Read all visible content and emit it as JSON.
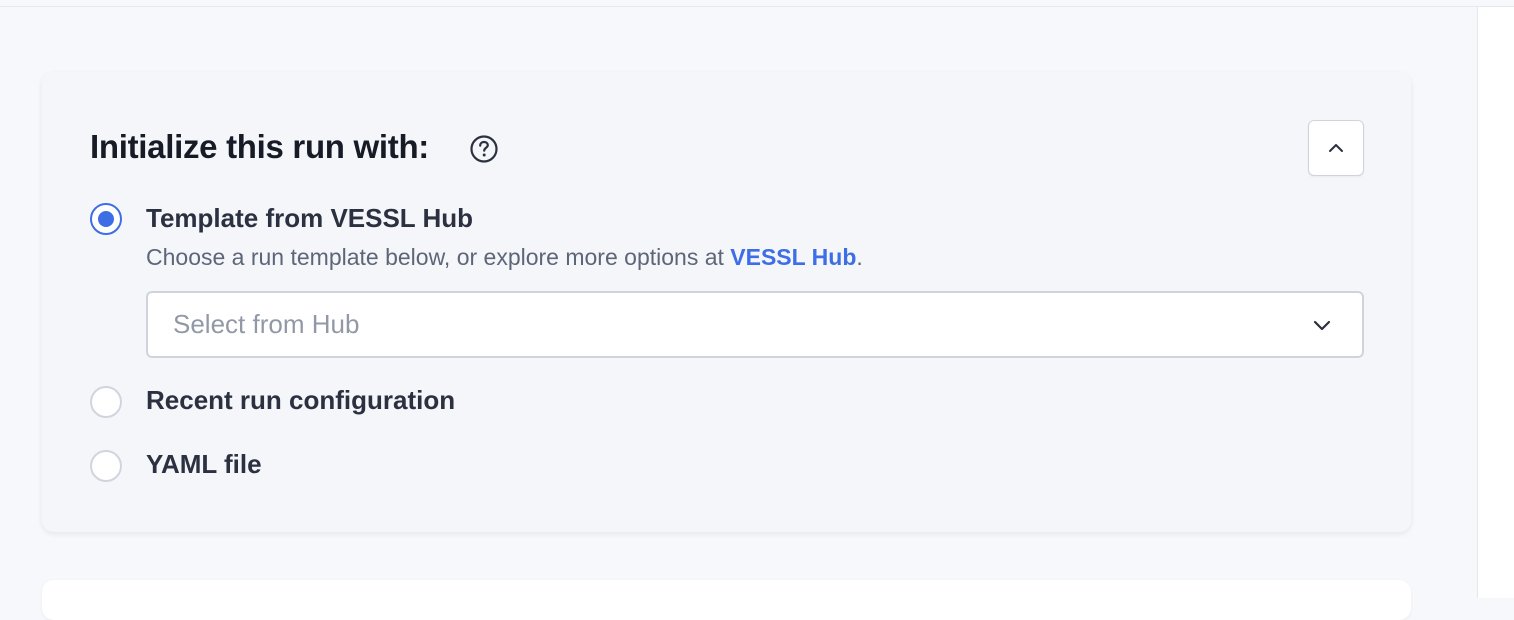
{
  "init_card": {
    "title": "Initialize this run with:",
    "help_icon": "question-circle-icon",
    "collapse_icon": "chevron-up-icon",
    "options": [
      {
        "label": "Template from VESSL Hub",
        "selected": true,
        "helper_prefix": "Choose a run template below, or explore more options at ",
        "helper_link": "VESSL Hub",
        "helper_suffix": ".",
        "select": {
          "placeholder": "Select from Hub",
          "icon": "chevron-down-icon"
        }
      },
      {
        "label": "Recent run configuration",
        "selected": false
      },
      {
        "label": "YAML file",
        "selected": false
      }
    ]
  },
  "colors": {
    "accent": "#3e6ee6",
    "page_background": "#f7f8fb",
    "card_background": "#f5f6fa",
    "title_text": "#161b26",
    "helper_text": "#5d6678",
    "placeholder_text": "#9299a6",
    "border": "#cfd4dc"
  }
}
